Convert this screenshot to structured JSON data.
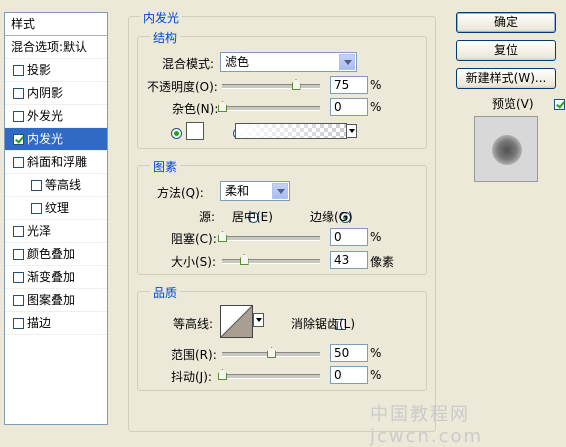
{
  "style_list": {
    "header": "样式",
    "blend_default": "混合选项:默认",
    "items": [
      {
        "label": "投影",
        "checked": false,
        "sub": false
      },
      {
        "label": "内阴影",
        "checked": false,
        "sub": false
      },
      {
        "label": "外发光",
        "checked": false,
        "sub": false
      },
      {
        "label": "内发光",
        "checked": true,
        "sub": false,
        "selected": true
      },
      {
        "label": "斜面和浮雕",
        "checked": false,
        "sub": false
      },
      {
        "label": "等高线",
        "checked": false,
        "sub": true
      },
      {
        "label": "纹理",
        "checked": false,
        "sub": true
      },
      {
        "label": "光泽",
        "checked": false,
        "sub": false
      },
      {
        "label": "颜色叠加",
        "checked": false,
        "sub": false
      },
      {
        "label": "渐变叠加",
        "checked": false,
        "sub": false
      },
      {
        "label": "图案叠加",
        "checked": false,
        "sub": false
      },
      {
        "label": "描边",
        "checked": false,
        "sub": false
      }
    ]
  },
  "panel": {
    "title": "内发光",
    "structure": {
      "title": "结构",
      "blend_mode_label": "混合模式:",
      "blend_mode_value": "滤色",
      "opacity_label": "不透明度(O):",
      "opacity_value": "75",
      "noise_label": "杂色(N):",
      "noise_value": "0",
      "percent": "%"
    },
    "elements": {
      "title": "图素",
      "method_label": "方法(Q):",
      "method_value": "柔和",
      "source_label": "源:",
      "source_center": "居中(E)",
      "source_edge": "边缘(G)",
      "choke_label": "阻塞(C):",
      "choke_value": "0",
      "size_label": "大小(S):",
      "size_value": "43",
      "percent": "%",
      "pixels": "像素"
    },
    "quality": {
      "title": "品质",
      "contour_label": "等高线:",
      "antialias_label": "消除锯齿(L)",
      "range_label": "范围(R):",
      "range_value": "50",
      "jitter_label": "抖动(J):",
      "jitter_value": "0",
      "percent": "%"
    }
  },
  "buttons": {
    "ok": "确定",
    "reset": "复位",
    "new_style": "新建样式(W)...",
    "preview_label": "预览(V)"
  },
  "sliders": {
    "opacity": 75,
    "noise": 0,
    "choke": 0,
    "size": 22,
    "range": 50,
    "jitter": 0
  },
  "watermark": "中国教程网 jcwcn.com",
  "colors": {
    "selection": "#316ac5",
    "group_title": "#0046d5",
    "background": "#ece9d8"
  }
}
